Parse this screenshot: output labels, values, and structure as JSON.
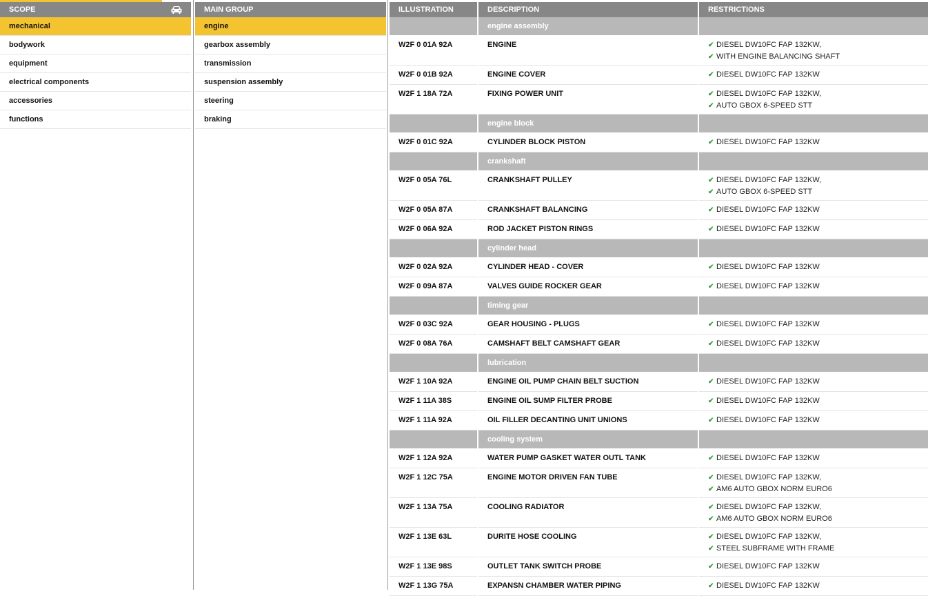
{
  "scope": {
    "header": "SCOPE",
    "items": [
      "mechanical",
      "bodywork",
      "equipment",
      "electrical components",
      "accessories",
      "functions"
    ],
    "active": "mechanical"
  },
  "main_group": {
    "header": "MAIN GROUP",
    "items": [
      "engine",
      "gearbox assembly",
      "transmission",
      "suspension assembly",
      "steering",
      "braking"
    ],
    "active": "engine"
  },
  "parts": {
    "headers": [
      "ILLUSTRATION",
      "DESCRIPTION",
      "RESTRICTIONS"
    ],
    "sections": [
      {
        "title": "engine assembly",
        "rows": [
          {
            "illustration": "W2F 0 01A 92A",
            "description": "ENGINE",
            "restrictions": [
              "DIESEL DW10FC FAP 132KW,",
              "WITH ENGINE BALANCING SHAFT"
            ]
          },
          {
            "illustration": "W2F 0 01B 92A",
            "description": "ENGINE COVER",
            "restrictions": [
              "DIESEL DW10FC FAP 132KW"
            ]
          },
          {
            "illustration": "W2F 1 18A 72A",
            "description": "FIXING POWER UNIT",
            "restrictions": [
              "DIESEL DW10FC FAP 132KW,",
              "AUTO GBOX 6-SPEED STT"
            ]
          }
        ]
      },
      {
        "title": "engine block",
        "rows": [
          {
            "illustration": "W2F 0 01C 92A",
            "description": "CYLINDER BLOCK PISTON",
            "restrictions": [
              "DIESEL DW10FC FAP 132KW"
            ]
          }
        ]
      },
      {
        "title": "crankshaft",
        "rows": [
          {
            "illustration": "W2F 0 05A 76L",
            "description": "CRANKSHAFT PULLEY",
            "restrictions": [
              "DIESEL DW10FC FAP 132KW,",
              "AUTO GBOX 6-SPEED STT"
            ]
          },
          {
            "illustration": "W2F 0 05A 87A",
            "description": "CRANKSHAFT BALANCING",
            "restrictions": [
              "DIESEL DW10FC FAP 132KW"
            ]
          },
          {
            "illustration": "W2F 0 06A 92A",
            "description": "ROD JACKET PISTON RINGS",
            "restrictions": [
              "DIESEL DW10FC FAP 132KW"
            ]
          }
        ]
      },
      {
        "title": "cylinder head",
        "rows": [
          {
            "illustration": "W2F 0 02A 92A",
            "description": "CYLINDER HEAD - COVER",
            "restrictions": [
              "DIESEL DW10FC FAP 132KW"
            ]
          },
          {
            "illustration": "W2F 0 09A 87A",
            "description": "VALVES GUIDE ROCKER GEAR",
            "restrictions": [
              "DIESEL DW10FC FAP 132KW"
            ]
          }
        ]
      },
      {
        "title": "timing gear",
        "rows": [
          {
            "illustration": "W2F 0 03C 92A",
            "description": "GEAR HOUSING - PLUGS",
            "restrictions": [
              "DIESEL DW10FC FAP 132KW"
            ]
          },
          {
            "illustration": "W2F 0 08A 76A",
            "description": "CAMSHAFT BELT CAMSHAFT GEAR",
            "restrictions": [
              "DIESEL DW10FC FAP 132KW"
            ]
          }
        ]
      },
      {
        "title": "lubrication",
        "rows": [
          {
            "illustration": "W2F 1 10A 92A",
            "description": "ENGINE OIL PUMP CHAIN BELT SUCTION",
            "restrictions": [
              "DIESEL DW10FC FAP 132KW"
            ]
          },
          {
            "illustration": "W2F 1 11A 38S",
            "description": "ENGINE OIL SUMP FILTER PROBE",
            "restrictions": [
              "DIESEL DW10FC FAP 132KW"
            ]
          },
          {
            "illustration": "W2F 1 11A 92A",
            "description": "OIL FILLER DECANTING UNIT UNIONS",
            "restrictions": [
              "DIESEL DW10FC FAP 132KW"
            ]
          }
        ]
      },
      {
        "title": "cooling system",
        "rows": [
          {
            "illustration": "W2F 1 12A 92A",
            "description": "WATER PUMP GASKET WATER OUTL TANK",
            "restrictions": [
              "DIESEL DW10FC FAP 132KW"
            ]
          },
          {
            "illustration": "W2F 1 12C 75A",
            "description": "ENGINE MOTOR DRIVEN FAN TUBE",
            "restrictions": [
              "DIESEL DW10FC FAP 132KW,",
              "AM6 AUTO GBOX NORM EURO6"
            ]
          },
          {
            "illustration": "W2F 1 13A 75A",
            "description": "COOLING RADIATOR",
            "restrictions": [
              "DIESEL DW10FC FAP 132KW,",
              "AM6 AUTO GBOX NORM EURO6"
            ]
          },
          {
            "illustration": "W2F 1 13E 63L",
            "description": "DURITE HOSE COOLING",
            "restrictions": [
              "DIESEL DW10FC FAP 132KW,",
              "STEEL SUBFRAME WITH FRAME"
            ]
          },
          {
            "illustration": "W2F 1 13E 98S",
            "description": "OUTLET TANK SWITCH PROBE",
            "restrictions": [
              "DIESEL DW10FC FAP 132KW"
            ]
          },
          {
            "illustration": "W2F 1 13G 75A",
            "description": "EXPANSN CHAMBER WATER PIPING",
            "restrictions": [
              "DIESEL DW10FC FAP 132KW"
            ]
          }
        ]
      }
    ]
  },
  "icons": {
    "scope_header": "car-icon",
    "restriction_mark": "check-icon"
  },
  "colors": {
    "accent": "#f4c430",
    "header_bg": "#878787",
    "section_bg": "#b8b8b8",
    "check": "#3aa03a"
  }
}
